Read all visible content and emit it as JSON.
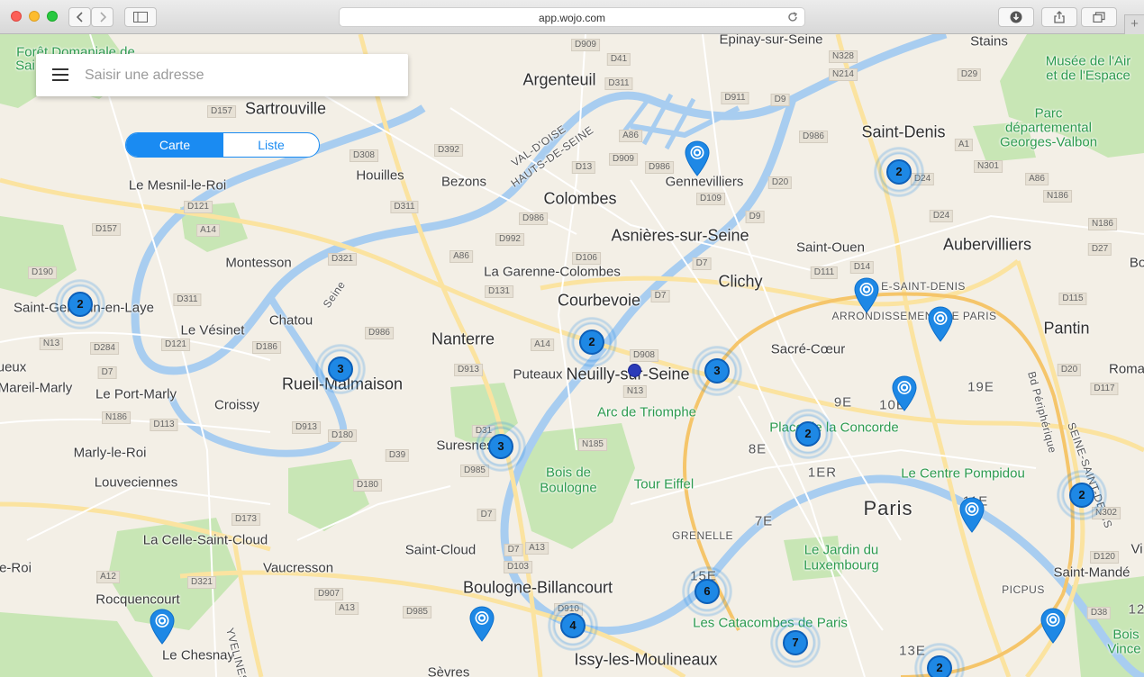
{
  "browser": {
    "url": "app.wojo.com",
    "traffic_lights": {
      "close": "#fc5f57",
      "minimize": "#fdbc2e",
      "maximize": "#28c840"
    }
  },
  "search": {
    "placeholder": "Saisir une adresse"
  },
  "view_toggle": {
    "map_label": "Carte",
    "list_label": "Liste",
    "active": "Carte"
  },
  "colors": {
    "accent": "#1a8bf2",
    "cluster": "#1e88e5",
    "park": "#c8e6b5",
    "water": "#a8cdf0",
    "road": "#fbe9a6"
  },
  "map_labels": [
    {
      "text": "Forêt Domaniale de",
      "style": "green"
    },
    {
      "text": "Sai",
      "style": "green"
    },
    {
      "text": "Sartrouville",
      "style": "big"
    },
    {
      "text": "Argenteuil",
      "style": "big"
    },
    {
      "text": "Epinay-sur-Seine",
      "style": ""
    },
    {
      "text": "Stains",
      "style": ""
    },
    {
      "text": "Musée de l'Air",
      "style": "green"
    },
    {
      "text": "et de l'Espace",
      "style": "green"
    },
    {
      "text": "Parc",
      "style": "green"
    },
    {
      "text": "départemental",
      "style": "green"
    },
    {
      "text": "Georges-Valbon",
      "style": "green"
    },
    {
      "text": "Saint-Denis",
      "style": "big"
    },
    {
      "text": "Gennevilliers",
      "style": ""
    },
    {
      "text": "Houilles",
      "style": ""
    },
    {
      "text": "Bezons",
      "style": ""
    },
    {
      "text": "Colombes",
      "style": "big"
    },
    {
      "text": "Le Mesnil-le-Roi",
      "style": ""
    },
    {
      "text": "Asnières-sur-Seine",
      "style": "big"
    },
    {
      "text": "Saint-Ouen",
      "style": ""
    },
    {
      "text": "Aubervilliers",
      "style": "big"
    },
    {
      "text": "Montesson",
      "style": ""
    },
    {
      "text": "La Garenne-Colombes",
      "style": ""
    },
    {
      "text": "Clichy",
      "style": "big"
    },
    {
      "text": "Courbevoie",
      "style": "big"
    },
    {
      "text": "Saint-Germain-en-Laye",
      "style": ""
    },
    {
      "text": "Chatou",
      "style": ""
    },
    {
      "text": "Le Vésinet",
      "style": ""
    },
    {
      "text": "Nanterre",
      "style": "big"
    },
    {
      "text": "Pantin",
      "style": "big"
    },
    {
      "text": "Sacré-Cœur",
      "style": ""
    },
    {
      "text": "ARRONDISSEMENT DE PARIS",
      "style": "small"
    },
    {
      "text": "E-SAINT-DENIS",
      "style": "small"
    },
    {
      "text": "Rueil-Malmaison",
      "style": "big"
    },
    {
      "text": "Puteaux",
      "style": ""
    },
    {
      "text": "Neuilly-sur-Seine",
      "style": "big"
    },
    {
      "text": "ueux",
      "style": ""
    },
    {
      "text": "Mareil-Marly",
      "style": ""
    },
    {
      "text": "Le Port-Marly",
      "style": ""
    },
    {
      "text": "Croissy",
      "style": ""
    },
    {
      "text": "Arc de Triomphe",
      "style": "green"
    },
    {
      "text": "9E",
      "style": "arr"
    },
    {
      "text": "10E",
      "style": "arr"
    },
    {
      "text": "19E",
      "style": "arr"
    },
    {
      "text": "Roma",
      "style": ""
    },
    {
      "text": "Place de la Concorde",
      "style": "green"
    },
    {
      "text": "Suresnes",
      "style": ""
    },
    {
      "text": "8E",
      "style": "arr"
    },
    {
      "text": "Marly-le-Roi",
      "style": ""
    },
    {
      "text": "1ER",
      "style": "arr"
    },
    {
      "text": "Le Centre Pompidou",
      "style": "green"
    },
    {
      "text": "Bois de",
      "style": "green"
    },
    {
      "text": "Boulogne",
      "style": "green"
    },
    {
      "text": "Tour Eiffel",
      "style": "green"
    },
    {
      "text": "Louveciennes",
      "style": ""
    },
    {
      "text": "Paris",
      "style": "xl"
    },
    {
      "text": "11E",
      "style": "arr"
    },
    {
      "text": "7E",
      "style": "arr"
    },
    {
      "text": "La Celle-Saint-Cloud",
      "style": ""
    },
    {
      "text": "GRENELLE",
      "style": "small"
    },
    {
      "text": "Saint-Cloud",
      "style": ""
    },
    {
      "text": "Le Jardin du",
      "style": "green"
    },
    {
      "text": "Luxembourg",
      "style": "green"
    },
    {
      "text": "e-Roi",
      "style": ""
    },
    {
      "text": "Vaucresson",
      "style": ""
    },
    {
      "text": "15E",
      "style": "arr"
    },
    {
      "text": "Saint-Mandé",
      "style": ""
    },
    {
      "text": "Boulogne-Billancourt",
      "style": "big"
    },
    {
      "text": "PICPUS",
      "style": "small"
    },
    {
      "text": "Rocquencourt",
      "style": ""
    },
    {
      "text": "Les Catacombes de Paris",
      "style": "green"
    },
    {
      "text": "Le Chesnay",
      "style": ""
    },
    {
      "text": "Issy-les-Moulineaux",
      "style": "big"
    },
    {
      "text": "13E",
      "style": "arr"
    },
    {
      "text": "Bois",
      "style": "green"
    },
    {
      "text": "Vince",
      "style": "green"
    },
    {
      "text": "Sèvres",
      "style": ""
    },
    {
      "text": "12",
      "style": "arr"
    },
    {
      "text": "Bo",
      "style": ""
    },
    {
      "text": "Vi",
      "style": ""
    },
    {
      "text": "Seine",
      "style": "small"
    },
    {
      "text": "VAL-D'OISE",
      "style": "small"
    },
    {
      "text": "HAUTS-DE-SEINE",
      "style": "small"
    },
    {
      "text": "YVELINES",
      "style": "small"
    },
    {
      "text": "SEINE-SAINT-DENIS",
      "style": "small"
    },
    {
      "text": "Bd Périphérique",
      "style": "small"
    }
  ],
  "road_shields": [
    "D909",
    "D41",
    "D311",
    "D911",
    "N328",
    "D9",
    "N214",
    "D29",
    "D157",
    "D392",
    "D986",
    "A86",
    "D13",
    "D909",
    "D986",
    "D109",
    "D20",
    "N301",
    "A1",
    "D24",
    "A86",
    "N186",
    "D308",
    "D311",
    "D121",
    "D986",
    "D992",
    "D9",
    "D24",
    "N186",
    "D157",
    "A14",
    "D321",
    "A86",
    "D106",
    "D7",
    "D111",
    "D14",
    "D27",
    "D190",
    "D311",
    "D131",
    "D7",
    "D115",
    "N13",
    "D284",
    "D121",
    "D186",
    "D986",
    "A14",
    "D908",
    "D913",
    "D20",
    "D117",
    "D7",
    "N13",
    "N186",
    "D113",
    "D913",
    "D180",
    "D31",
    "N185",
    "D39",
    "D985",
    "D7",
    "D180",
    "D173",
    "D7",
    "A13",
    "D103",
    "A12",
    "D321",
    "D907",
    "A13",
    "D910",
    "D985",
    "N302",
    "D120",
    "D38"
  ],
  "clusters": [
    {
      "count": "2"
    },
    {
      "count": "2"
    },
    {
      "count": "2"
    },
    {
      "count": "3"
    },
    {
      "count": "3"
    },
    {
      "count": "3"
    },
    {
      "count": "2"
    },
    {
      "count": "2"
    },
    {
      "count": "6"
    },
    {
      "count": "4"
    },
    {
      "count": "7"
    },
    {
      "count": "2"
    }
  ],
  "pins": [
    {
      "icon": "location-pin-icon"
    },
    {
      "icon": "location-pin-icon"
    },
    {
      "icon": "location-pin-icon"
    },
    {
      "icon": "location-pin-icon"
    },
    {
      "icon": "location-pin-icon"
    },
    {
      "icon": "location-pin-icon"
    },
    {
      "icon": "location-pin-icon"
    },
    {
      "icon": "location-pin-icon"
    }
  ]
}
